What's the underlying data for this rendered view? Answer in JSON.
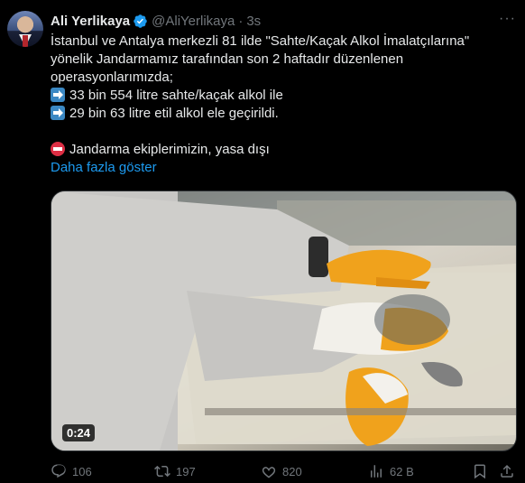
{
  "author": {
    "name": "Ali Yerlikaya",
    "handle": "@AliYerlikaya",
    "separator": "·",
    "time": "3s"
  },
  "more_label": "···",
  "tweet": {
    "line1": "İstanbul ve Antalya merkezli 81 ilde \"Sahte/Kaçak Alkol İmalatçılarına\" yönelik Jandarmamız tarafından son 2 haftadır düzenlenen operasyonlarımızda;",
    "bullet1": "33 bin 554 litre sahte/kaçak alkol ile",
    "bullet2": "29 bin 63 litre etil alkol ele geçirildi.",
    "line_warning": "Jandarma ekiplerimizin, yasa dışı",
    "show_more": "Daha fazla göster"
  },
  "media": {
    "duration": "0:24"
  },
  "actions": {
    "replies": "106",
    "reposts": "197",
    "likes": "820",
    "views": "62 B"
  },
  "colors": {
    "background": "#000000",
    "text": "#e7e9ea",
    "secondary": "#71767b",
    "link": "#1d9bf0",
    "verified": "#1d9bf0"
  }
}
